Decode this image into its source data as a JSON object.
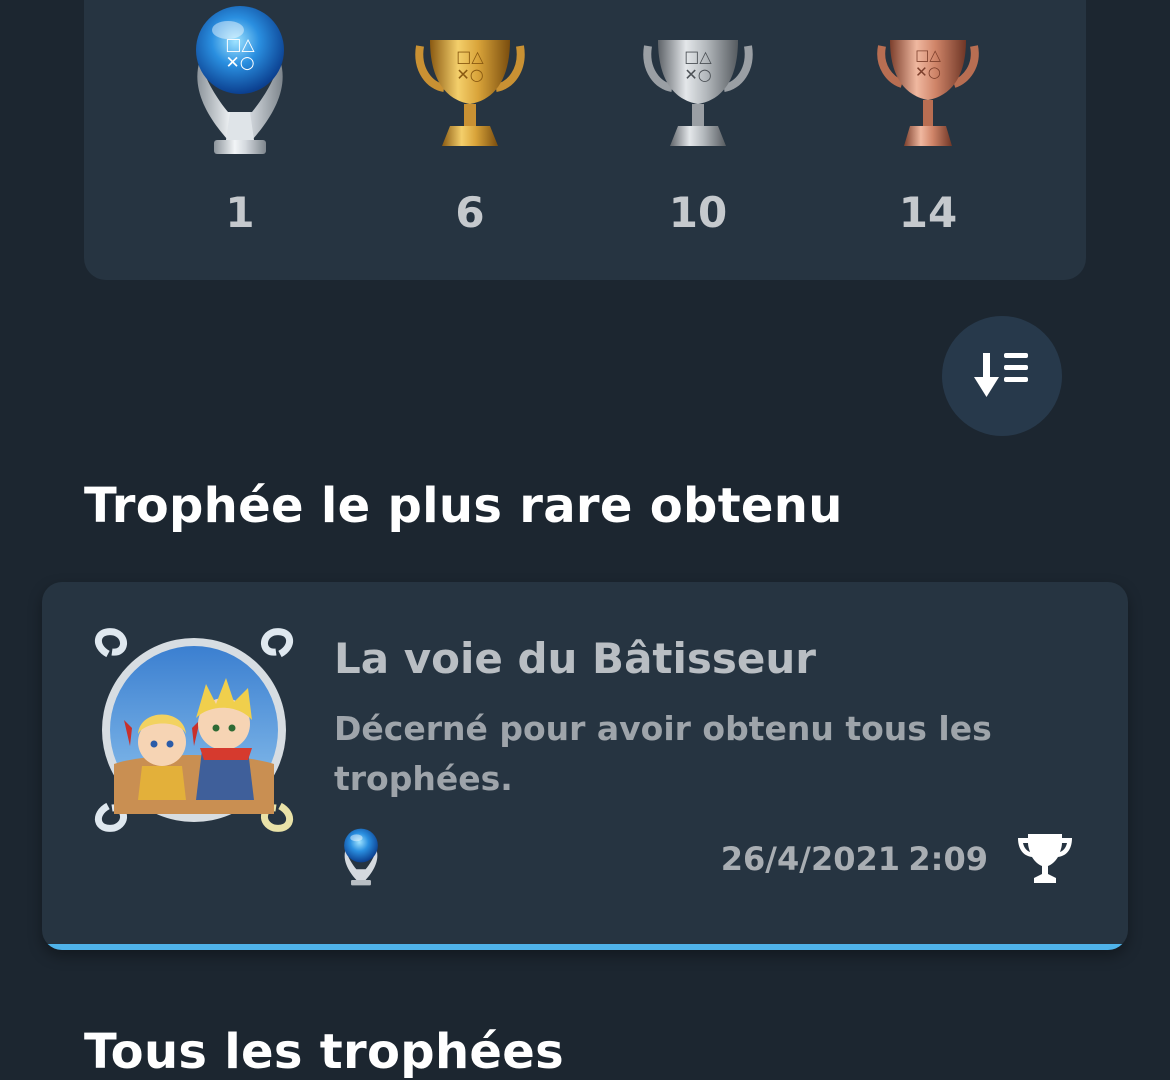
{
  "summary": {
    "trophies": [
      {
        "grade": "platinum",
        "icon": "platinum-trophy-icon",
        "count": "1"
      },
      {
        "grade": "gold",
        "icon": "gold-trophy-icon",
        "count": "6"
      },
      {
        "grade": "silver",
        "icon": "silver-trophy-icon",
        "count": "10"
      },
      {
        "grade": "bronze",
        "icon": "bronze-trophy-icon",
        "count": "14"
      }
    ]
  },
  "sort_button": {
    "icon": "sort-descending-icon"
  },
  "rarest_section": {
    "heading": "Trophée le plus rare obtenu",
    "trophy": {
      "name": "La voie du Bâtisseur",
      "description": "Décerné pour avoir obtenu tous les trophées.",
      "grade": "platinum",
      "grade_icon": "platinum-trophy-icon",
      "date": "26/4/2021",
      "time": "2:09",
      "earned_icon": "trophy-earned-icon"
    }
  },
  "all_section": {
    "heading": "Tous les trophées"
  },
  "colors": {
    "background": "#1c2630",
    "card": "#263441",
    "accent": "#4fb3ea"
  }
}
